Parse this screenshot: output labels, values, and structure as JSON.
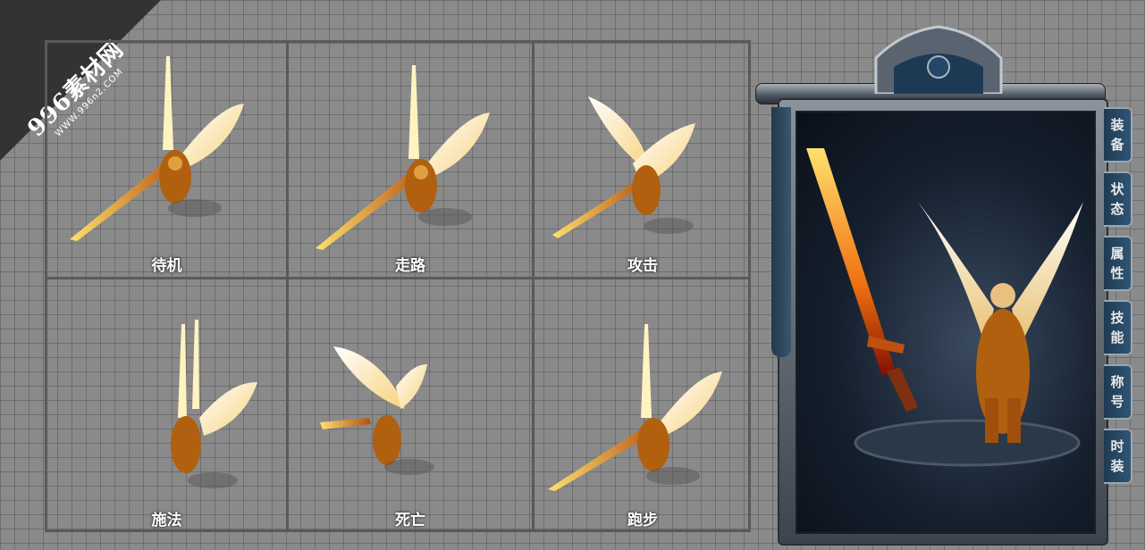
{
  "watermark": {
    "title": "996素材网",
    "url": "WWW.996n2.COM"
  },
  "actions": [
    {
      "label": "待机"
    },
    {
      "label": "走路"
    },
    {
      "label": "攻击"
    },
    {
      "label": "施法"
    },
    {
      "label": "死亡"
    },
    {
      "label": "跑步"
    }
  ],
  "panel": {
    "tabs": [
      {
        "label": "装备"
      },
      {
        "label": "状态"
      },
      {
        "label": "属性"
      },
      {
        "label": "技能"
      },
      {
        "label": "称号"
      },
      {
        "label": "时装"
      }
    ]
  },
  "colors": {
    "background": "#8a8a8a",
    "grid_line": "#5a5a5a",
    "tab_fill": "#2f5573",
    "gold": "#f0a020"
  },
  "icons": [
    "winged-knight-sprite",
    "flaming-sword-icon",
    "crest-ornament-icon"
  ]
}
